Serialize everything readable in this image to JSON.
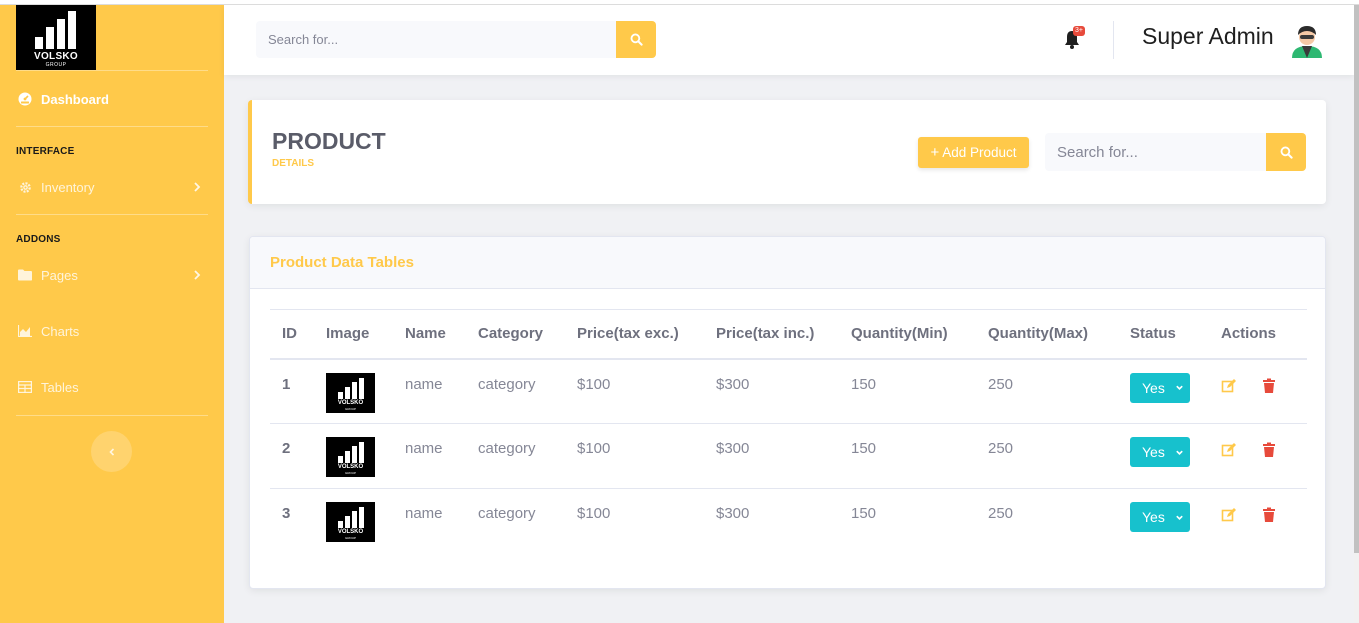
{
  "brand": {
    "name": "VOLSKO",
    "sub": "GROUP"
  },
  "sidebar": {
    "dashboard": "Dashboard",
    "section_interface": "INTERFACE",
    "inventory": "Inventory",
    "section_addons": "ADDONS",
    "pages": "Pages",
    "charts": "Charts",
    "tables": "Tables"
  },
  "topbar": {
    "search_placeholder": "Search for...",
    "alert_badge": "3+",
    "user_name": "Super Admin"
  },
  "page_header": {
    "title": "PRODUCT",
    "subtitle": "DETAILS",
    "add_button": "Add Product",
    "search_placeholder": "Search for..."
  },
  "table_card": {
    "title": "Product Data Tables",
    "columns": [
      "ID",
      "Image",
      "Name",
      "Category",
      "Price(tax exc.)",
      "Price(tax inc.)",
      "Quantity(Min)",
      "Quantity(Max)",
      "Status",
      "Actions"
    ],
    "rows": [
      {
        "id": "1",
        "name": "name",
        "category": "category",
        "price_exc": "$100",
        "price_inc": "$300",
        "qty_min": "150",
        "qty_max": "250",
        "status": "Yes"
      },
      {
        "id": "2",
        "name": "name",
        "category": "category",
        "price_exc": "$100",
        "price_inc": "$300",
        "qty_min": "150",
        "qty_max": "250",
        "status": "Yes"
      },
      {
        "id": "3",
        "name": "name",
        "category": "category",
        "price_exc": "$100",
        "price_inc": "$300",
        "qty_min": "150",
        "qty_max": "250",
        "status": "Yes"
      }
    ]
  },
  "colors": {
    "accent": "#ffc94a",
    "status": "#17c1cd",
    "edit": "#ffc94a",
    "delete": "#e74a3b"
  }
}
